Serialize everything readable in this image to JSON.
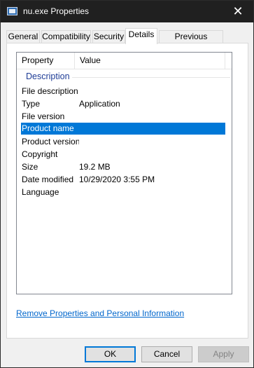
{
  "window": {
    "title": "nu.exe Properties",
    "close_glyph": "✕"
  },
  "tabs": [
    {
      "label": "General"
    },
    {
      "label": "Compatibility"
    },
    {
      "label": "Security"
    },
    {
      "label": "Details",
      "active": true
    },
    {
      "label": "Previous Versions"
    }
  ],
  "details": {
    "columns": {
      "property": "Property",
      "value": "Value"
    },
    "group": "Description",
    "rows": [
      {
        "property": "File description",
        "value": ""
      },
      {
        "property": "Type",
        "value": "Application"
      },
      {
        "property": "File version",
        "value": ""
      },
      {
        "property": "Product name",
        "value": "",
        "selected": true
      },
      {
        "property": "Product version",
        "value": ""
      },
      {
        "property": "Copyright",
        "value": ""
      },
      {
        "property": "Size",
        "value": "19.2 MB"
      },
      {
        "property": "Date modified",
        "value": "10/29/2020 3:55 PM"
      },
      {
        "property": "Language",
        "value": ""
      }
    ]
  },
  "remove_link": "Remove Properties and Personal Information",
  "buttons": {
    "ok": "OK",
    "cancel": "Cancel",
    "apply": "Apply"
  },
  "colors": {
    "selection": "#0078d7",
    "group_header": "#1e3c96",
    "link": "#0066cc"
  }
}
